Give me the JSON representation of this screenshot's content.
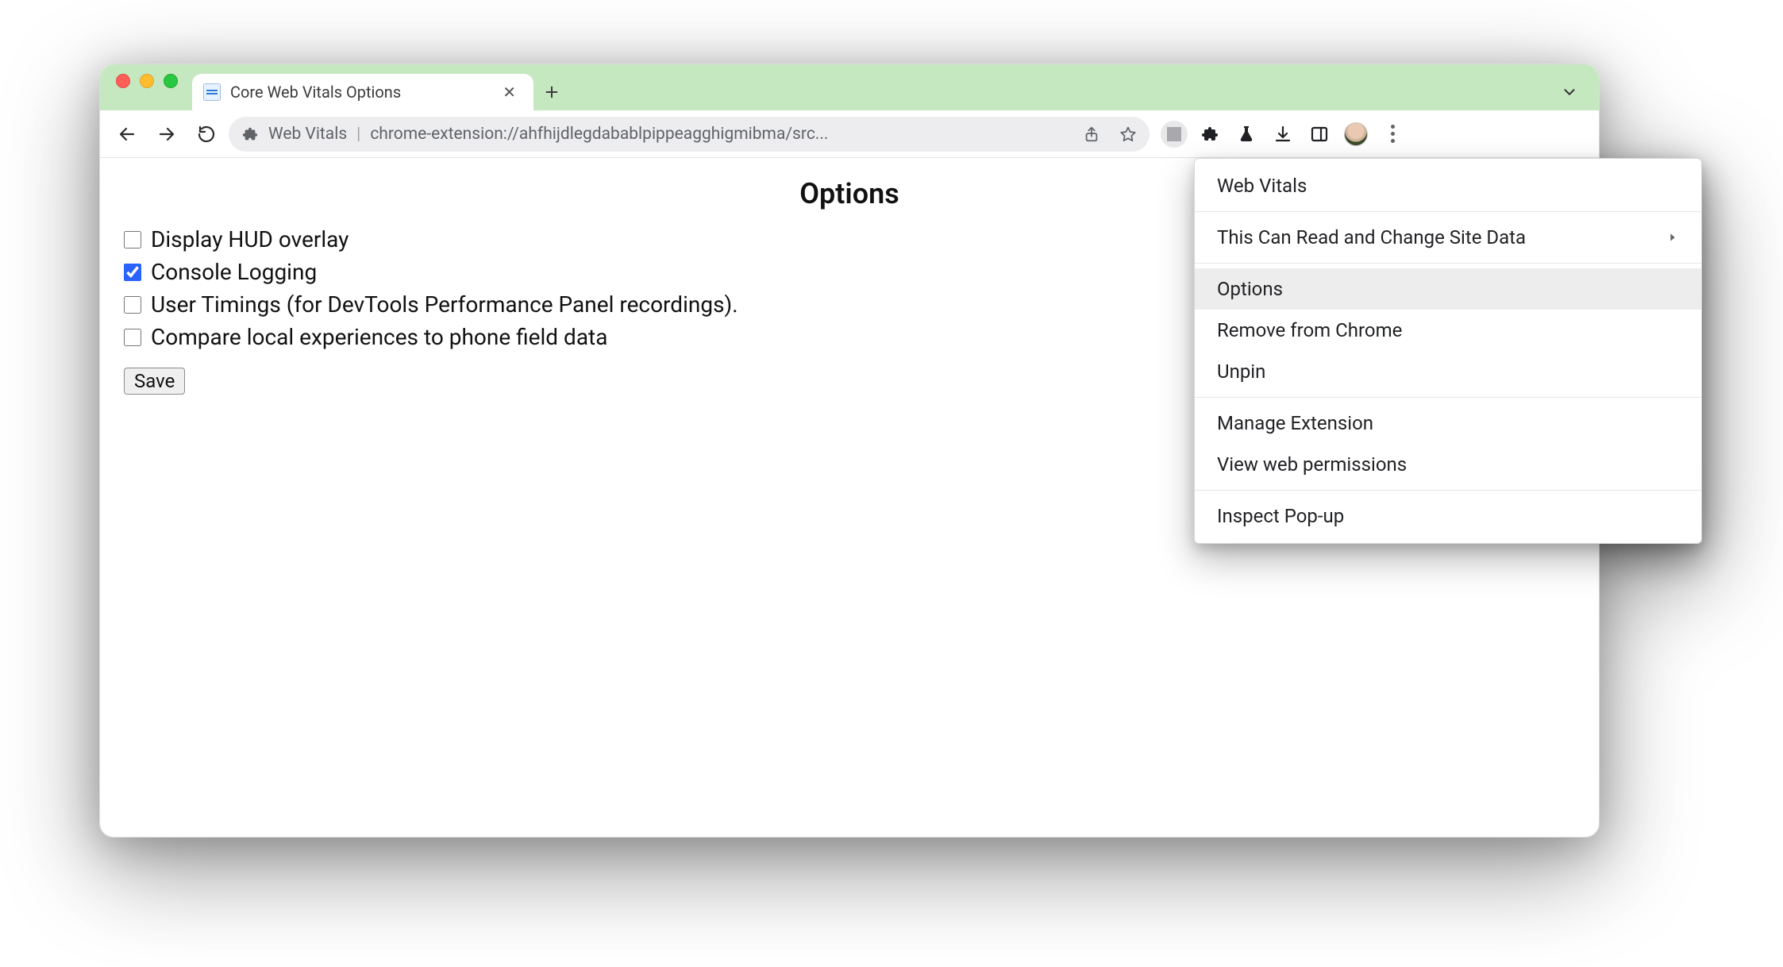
{
  "tab": {
    "title": "Core Web Vitals Options"
  },
  "omnibox": {
    "site_name": "Web Vitals",
    "url": "chrome-extension://ahfhijdlegdabablpippeagghigmibma/src..."
  },
  "options": {
    "heading": "Options",
    "items": [
      {
        "label": "Display HUD overlay",
        "checked": false
      },
      {
        "label": "Console Logging",
        "checked": true
      },
      {
        "label": "User Timings (for DevTools Performance Panel recordings).",
        "checked": false
      },
      {
        "label": "Compare local experiences to phone field data",
        "checked": false
      }
    ],
    "save_label": "Save"
  },
  "context_menu": {
    "header": "Web Vitals",
    "site_data": "This Can Read and Change Site Data",
    "options": "Options",
    "remove": "Remove from Chrome",
    "unpin": "Unpin",
    "manage": "Manage Extension",
    "view_perms": "View web permissions",
    "inspect": "Inspect Pop-up"
  }
}
